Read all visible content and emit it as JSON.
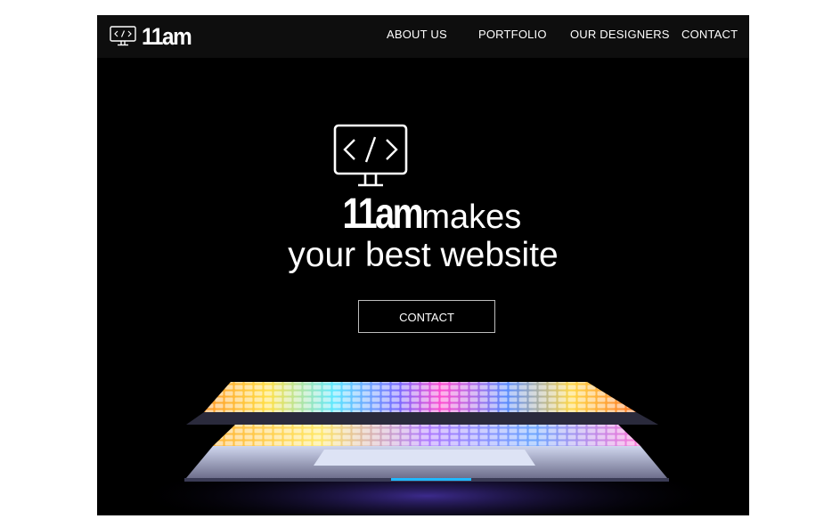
{
  "navbar": {
    "brand": "11am",
    "logo_icon": "code-monitor-icon",
    "links": [
      {
        "label": "ABOUT US"
      },
      {
        "label": "PORTFOLIO"
      },
      {
        "label": "OUR DESIGNERS"
      },
      {
        "label": "CONTACT"
      }
    ]
  },
  "hero": {
    "icon": "code-monitor-icon",
    "brand": "11am",
    "headline_rest": "makes",
    "headline_line2": "your best website",
    "cta_label": "CONTACT"
  },
  "image": {
    "subject": "laptop-with-glowing-rainbow-keyboard-icon"
  },
  "colors": {
    "page_bg": "#ffffff",
    "stage_bg": "#000000",
    "navbar_bg": "#0e0e0e",
    "text": "#ffffff",
    "cta_border": "#bdbdbd"
  }
}
